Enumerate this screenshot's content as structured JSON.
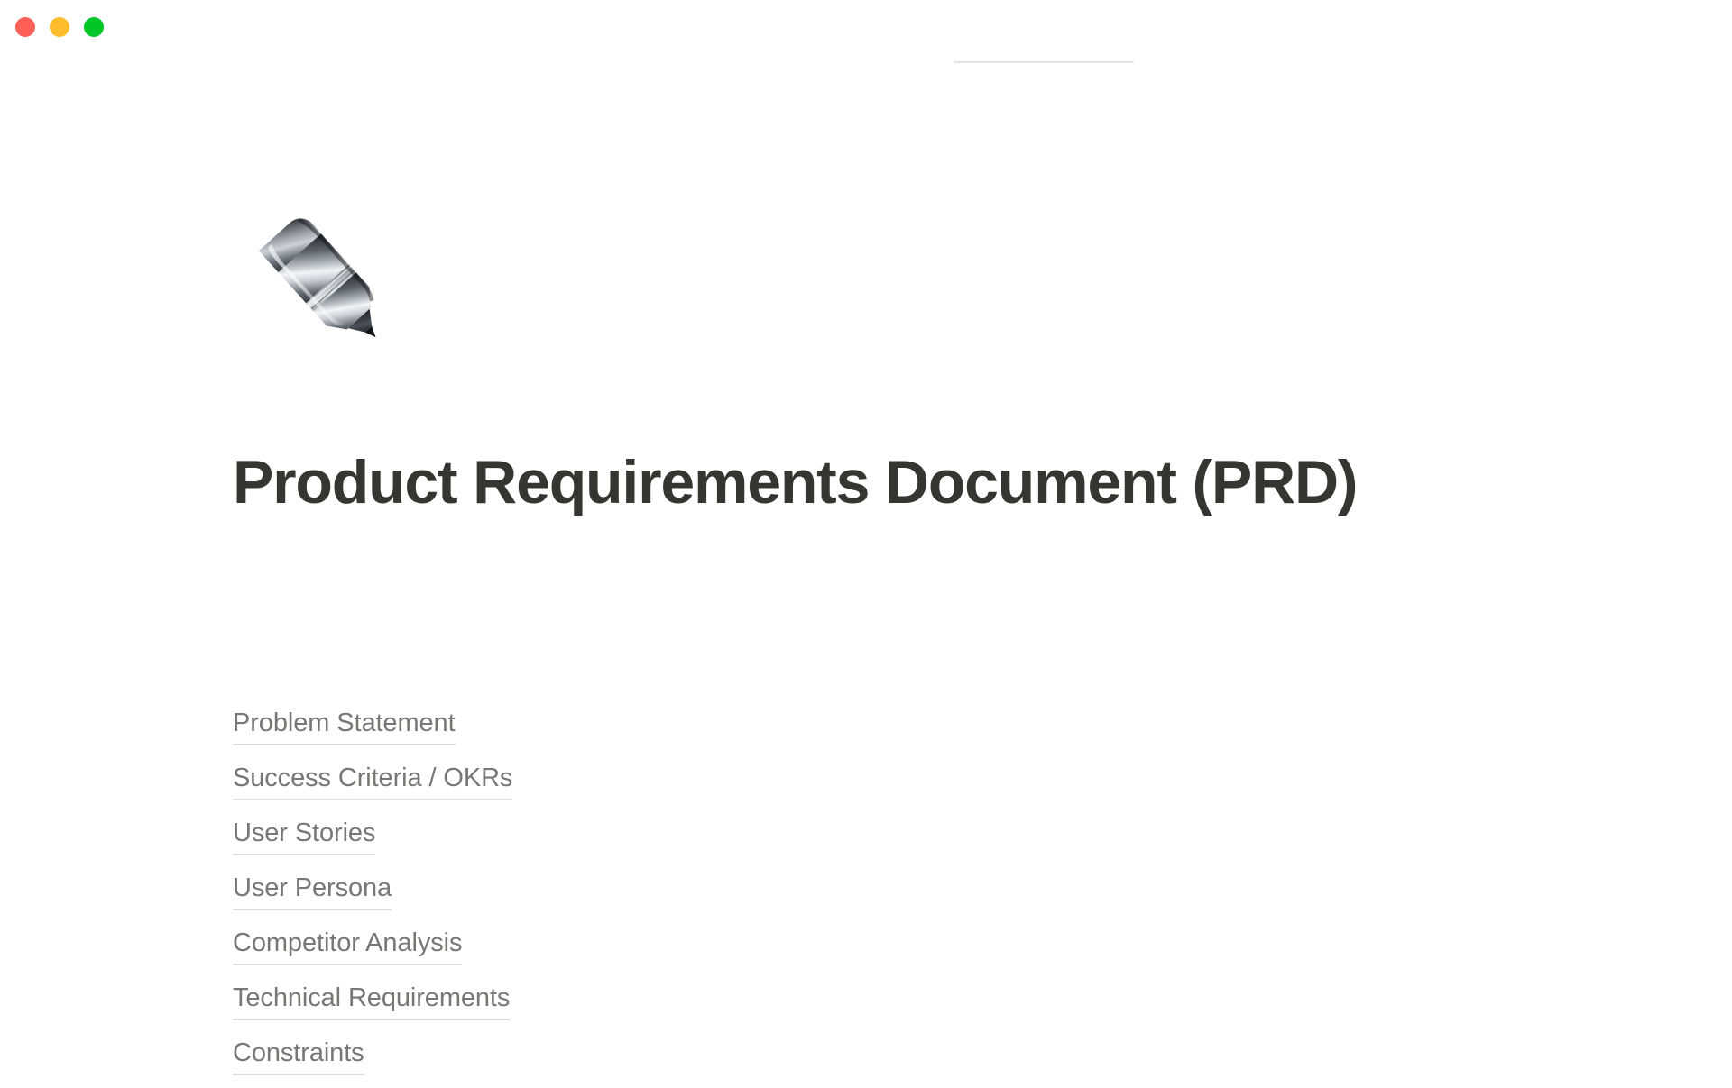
{
  "window": {
    "traffic_lights": [
      {
        "name": "close",
        "color": "#FF5F57"
      },
      {
        "name": "minimize",
        "color": "#FFBD2E"
      },
      {
        "name": "maximize",
        "color": "#00C728"
      }
    ]
  },
  "document": {
    "icon": "pen-emoji",
    "icon_glyph": "🖊️",
    "title": "Product Requirements Document (PRD)",
    "title_color": "#37352F",
    "link_color": "#787774",
    "link_underline_color": "#DCDCDA",
    "background_color": "#FFFFFF",
    "toc": [
      {
        "label": "Problem Statement"
      },
      {
        "label": "Success Criteria / OKRs"
      },
      {
        "label": "User Stories"
      },
      {
        "label": "User Persona"
      },
      {
        "label": "Competitor Analysis"
      },
      {
        "label": "Technical Requirements"
      },
      {
        "label": "Constraints"
      }
    ]
  }
}
